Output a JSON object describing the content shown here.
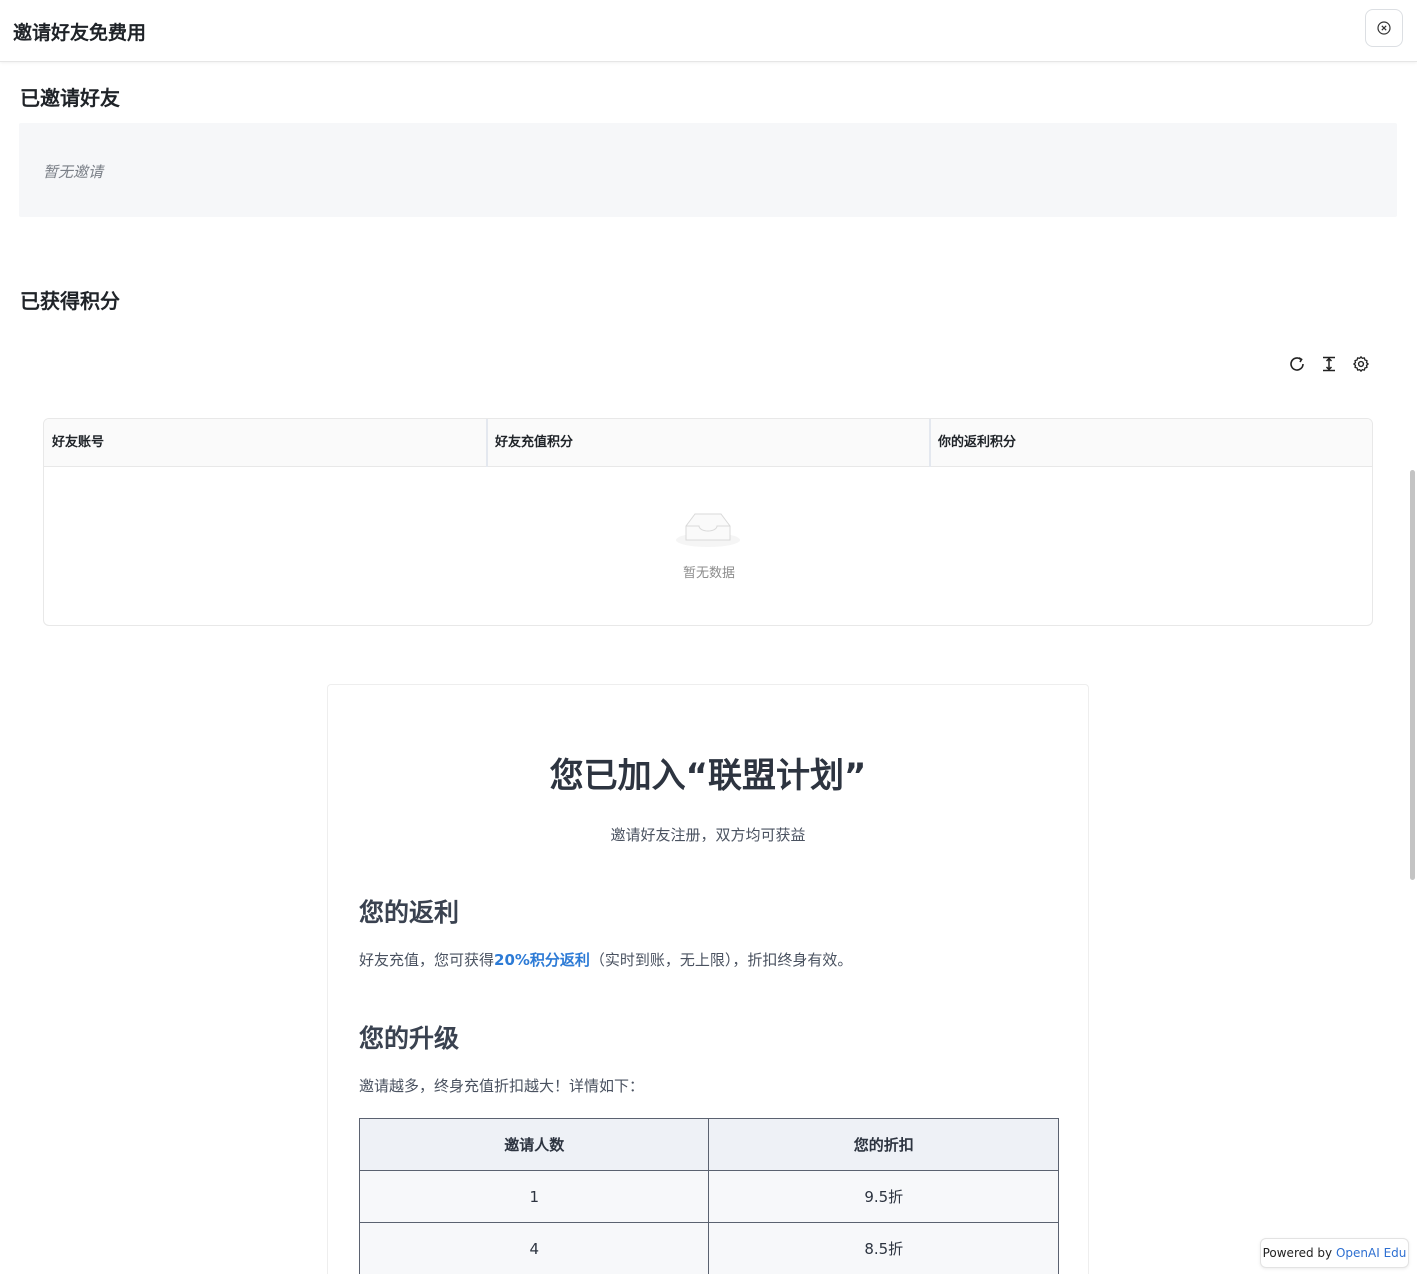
{
  "header": {
    "title": "邀请好友免费用",
    "close_icon": "close-circle-icon"
  },
  "invited": {
    "title": "已邀请好友",
    "empty_text": "暂无邀请"
  },
  "points": {
    "title": "已获得积分",
    "toolbar": [
      {
        "name": "refresh-icon",
        "icon": "refresh-icon"
      },
      {
        "name": "density-icon",
        "icon": "column-height-icon"
      },
      {
        "name": "settings-icon",
        "icon": "gear-icon"
      }
    ],
    "table": {
      "columns": [
        "好友账号",
        "好友充值积分",
        "你的返利积分"
      ],
      "empty_text": "暂无数据",
      "empty_icon": "inbox-icon"
    }
  },
  "program": {
    "title": "您已加入“联盟计划”",
    "subtitle": "邀请好友注册，双方均可获益",
    "rebate": {
      "heading": "您的返利",
      "text_before": "好友充值，您可获得",
      "highlight": "20%积分返利",
      "text_after": "（实时到账，无上限），折扣终身有效。"
    },
    "upgrade": {
      "heading": "您的升级",
      "text": "邀请越多，终身充值折扣越大！详情如下：",
      "table": {
        "headers": [
          "邀请人数",
          "您的折扣"
        ],
        "rows": [
          [
            "1",
            "9.5折"
          ],
          [
            "4",
            "8.5折"
          ]
        ]
      }
    }
  },
  "footer": {
    "powered_prefix": "Powered by ",
    "brand": "OpenAI Edu"
  },
  "colors": {
    "accent": "#2d7bd6",
    "brand_link": "#2d6fd1"
  }
}
